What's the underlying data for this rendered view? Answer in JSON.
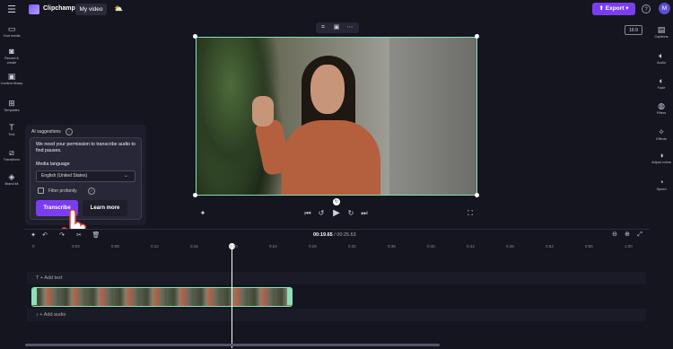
{
  "app": {
    "brand": "Clipchamp",
    "project_title": "My video",
    "export_label": "Export",
    "avatar_initial": "M",
    "accent_color": "#7b3df2",
    "selection_color": "#8be0b8"
  },
  "left_sidebar": [
    {
      "label": "Your media",
      "icon": "folder-icon"
    },
    {
      "label": "Record & create",
      "icon": "camera-icon"
    },
    {
      "label": "Content library",
      "icon": "library-icon"
    },
    {
      "label": "Templates",
      "icon": "templates-icon"
    },
    {
      "label": "Text",
      "icon": "text-icon"
    },
    {
      "label": "Transitions",
      "icon": "transitions-icon"
    },
    {
      "label": "Brand kit",
      "icon": "brand-kit-icon"
    }
  ],
  "right_sidebar": [
    {
      "label": "Captions",
      "icon": "captions-icon"
    },
    {
      "label": "Audio",
      "icon": "speaker-icon"
    },
    {
      "label": "Fade",
      "icon": "fade-icon"
    },
    {
      "label": "Filters",
      "icon": "filters-icon"
    },
    {
      "label": "Effects",
      "icon": "effects-icon"
    },
    {
      "label": "Adjust colors",
      "icon": "adjust-colors-icon"
    },
    {
      "label": "Speed",
      "icon": "speed-icon"
    }
  ],
  "preview": {
    "aspect_ratio": "16:9"
  },
  "ai_panel": {
    "title": "AI suggestions",
    "message": "We need your permission to transcribe audio to find pauses.",
    "media_language_label": "Media language",
    "language_value": "English (United States)",
    "filter_profanity_label": "Filter profanity",
    "filter_profanity_checked": false,
    "transcribe_label": "Transcribe",
    "learn_more_label": "Learn more"
  },
  "timeline": {
    "current_time": "00:19.65",
    "total_time": "/ 00:25.63",
    "ruler_labels": [
      "0",
      "0:04",
      "0:08",
      "0:12",
      "0:16",
      "0:20",
      "0:24",
      "0:28",
      "0:32",
      "0:36",
      "0:40",
      "0:44",
      "0:48",
      "0:52",
      "0:56",
      "1:00"
    ],
    "add_text_label": "+ Add text",
    "add_audio_label": "+ Add audio"
  }
}
